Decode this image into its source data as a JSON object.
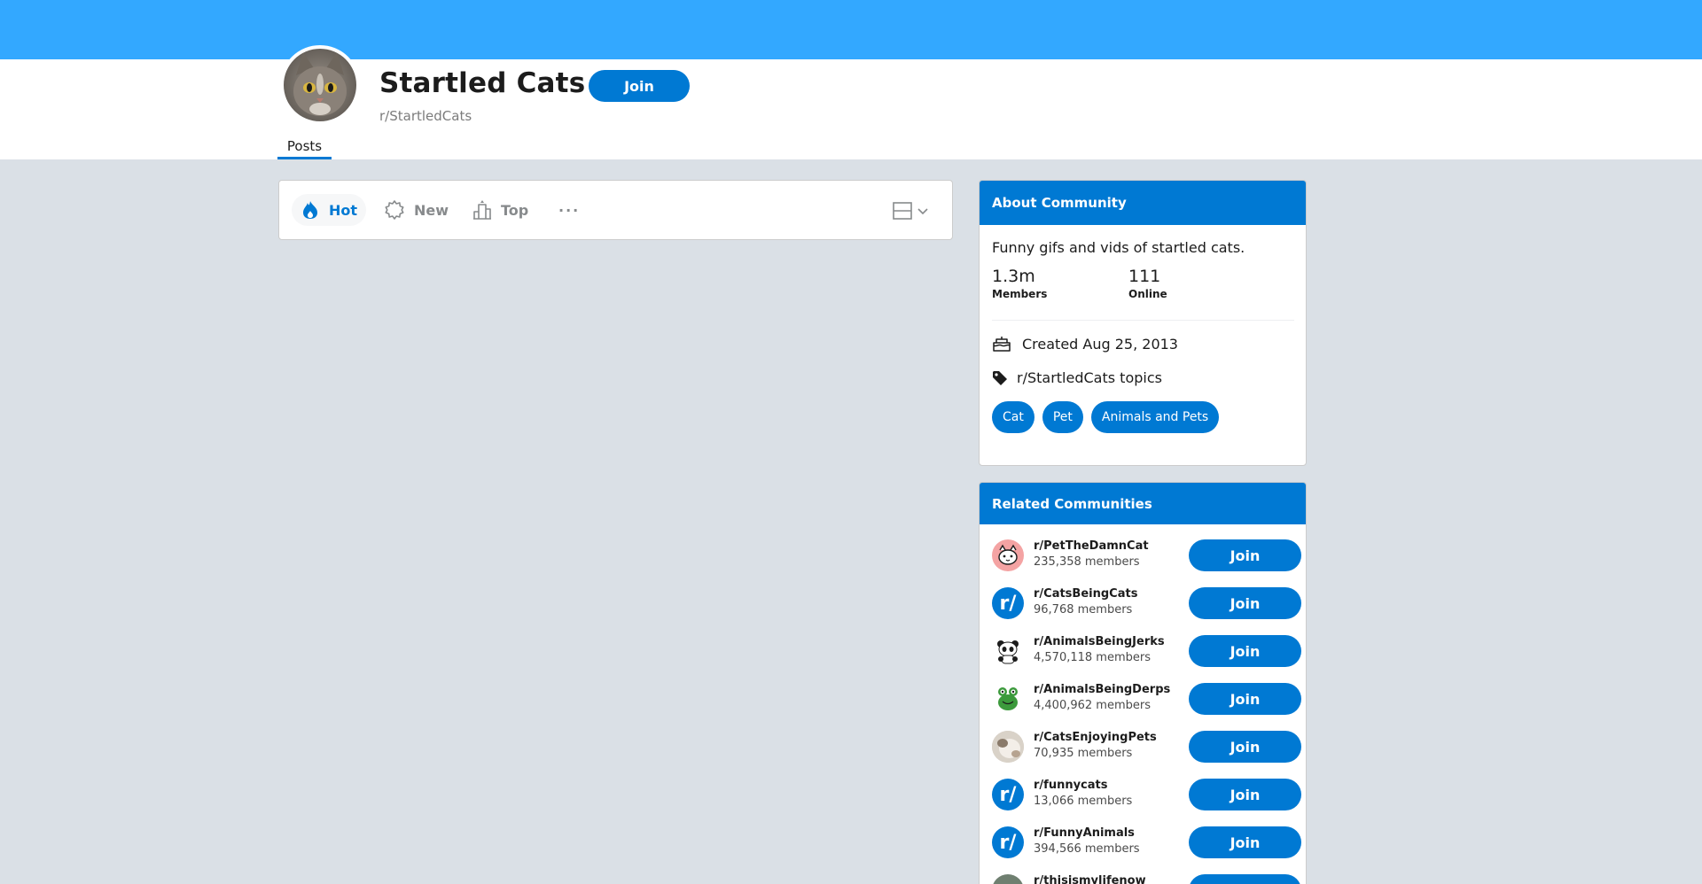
{
  "community": {
    "title": "Startled Cats",
    "handle": "r/StartledCats",
    "join_label": "Join",
    "tab_posts": "Posts"
  },
  "sort": {
    "hot": "Hot",
    "new": "New",
    "top": "Top",
    "more": "···"
  },
  "about": {
    "header": "About Community",
    "description": "Funny gifs and vids of startled cats.",
    "members_count": "1.3m",
    "members_label": "Members",
    "online_count": "111",
    "online_label": "Online",
    "created": "Created Aug 25, 2013",
    "topics_label": "r/StartledCats topics",
    "topics": [
      "Cat",
      "Pet",
      "Animals and Pets"
    ]
  },
  "related": {
    "header": "Related Communities",
    "items": [
      {
        "name": "r/PetTheDamnCat",
        "members": "235,358 members",
        "join": "Join",
        "icon": "cat-face-icon"
      },
      {
        "name": "r/CatsBeingCats",
        "members": "96,768 members",
        "join": "Join",
        "icon": "reddit-r-icon"
      },
      {
        "name": "r/AnimalsBeingJerks",
        "members": "4,570,118 members",
        "join": "Join",
        "icon": "panda-icon"
      },
      {
        "name": "r/AnimalsBeingDerps",
        "members": "4,400,962 members",
        "join": "Join",
        "icon": "frog-icon"
      },
      {
        "name": "r/CatsEnjoyingPets",
        "members": "70,935 members",
        "join": "Join",
        "icon": "cat-photo-icon"
      },
      {
        "name": "r/funnycats",
        "members": "13,066 members",
        "join": "Join",
        "icon": "reddit-r-icon"
      },
      {
        "name": "r/FunnyAnimals",
        "members": "394,566 members",
        "join": "Join",
        "icon": "reddit-r-icon"
      },
      {
        "name": "r/thisismylifenow",
        "members": "",
        "join": "Join",
        "icon": "avatar-photo-icon"
      }
    ]
  },
  "colors": {
    "banner": "#33a8ff",
    "accent": "#0079d3",
    "background": "#dae0e6"
  }
}
